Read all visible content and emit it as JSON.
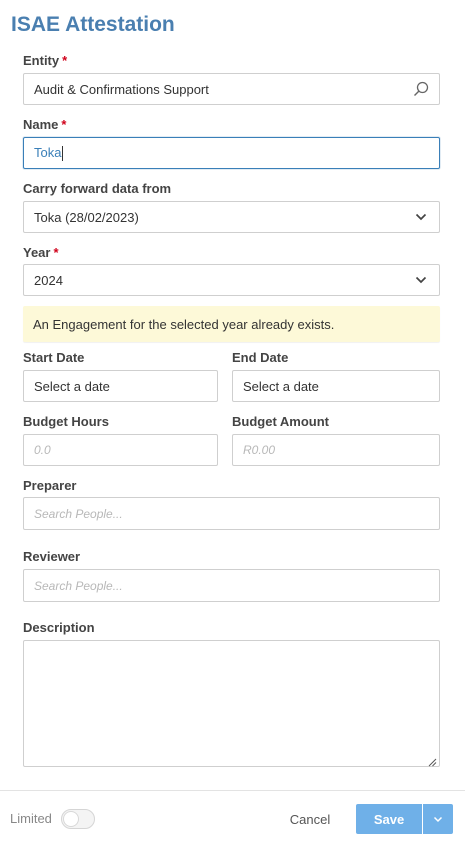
{
  "page": {
    "title": "ISAE Attestation"
  },
  "entity": {
    "label": "Entity",
    "required_mark": "*",
    "value": "Audit & Confirmations Support",
    "icon": "search-icon"
  },
  "name": {
    "label": "Name",
    "required_mark": "*",
    "value": "Toka"
  },
  "carry_forward": {
    "label": "Carry forward data from",
    "value": "Toka (28/02/2023)",
    "icon": "chevron-down-icon"
  },
  "year": {
    "label": "Year",
    "required_mark": "*",
    "value": "2024",
    "icon": "chevron-down-icon"
  },
  "notice": {
    "text": "An Engagement for the selected year already exists.",
    "color": "#fdf9d8"
  },
  "start_date": {
    "label": "Start Date",
    "placeholder": "Select a date"
  },
  "end_date": {
    "label": "End Date",
    "placeholder": "Select a date"
  },
  "budget_hours": {
    "label": "Budget Hours",
    "placeholder": "0.0"
  },
  "budget_amount": {
    "label": "Budget Amount",
    "placeholder": "R0.00"
  },
  "preparer": {
    "label": "Preparer",
    "placeholder": "Search People..."
  },
  "reviewer": {
    "label": "Reviewer",
    "placeholder": "Search People..."
  },
  "description": {
    "label": "Description",
    "value": ""
  },
  "footer": {
    "limited_label": "Limited",
    "limited_on": false,
    "cancel_label": "Cancel",
    "save_label": "Save",
    "accent_color": "#6fb0e8"
  }
}
